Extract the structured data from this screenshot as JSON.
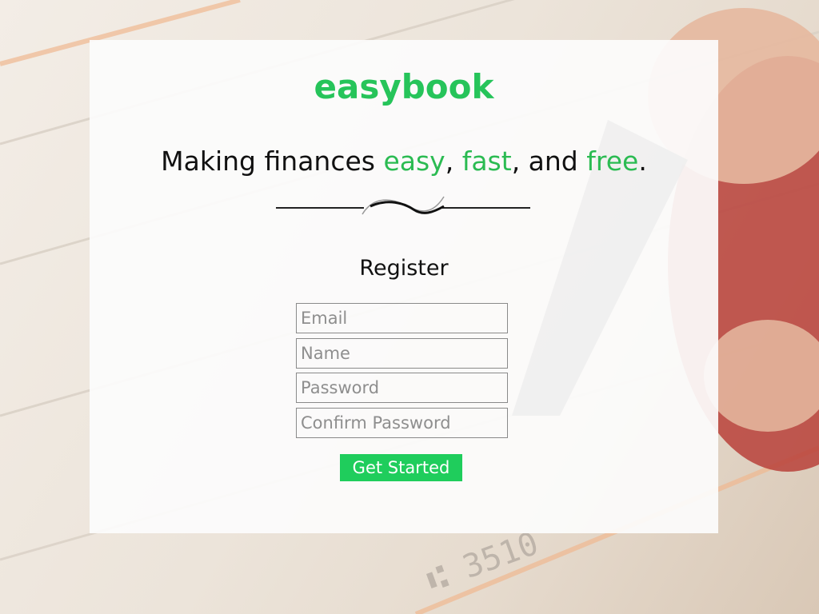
{
  "brand": {
    "logo_text": "easybook",
    "accent_color": "#26c45a"
  },
  "tagline": {
    "prefix": "Making finances ",
    "word1": "easy",
    "sep1": ", ",
    "word2": "fast",
    "sep2": ", and ",
    "word3": "free",
    "suffix": "."
  },
  "register": {
    "title": "Register",
    "fields": {
      "email": {
        "placeholder": "Email",
        "value": ""
      },
      "name": {
        "placeholder": "Name",
        "value": ""
      },
      "password": {
        "placeholder": "Password",
        "value": ""
      },
      "confirm_password": {
        "placeholder": "Confirm Password",
        "value": ""
      }
    },
    "submit_label": "Get Started",
    "submit_color": "#1fcd5c"
  }
}
